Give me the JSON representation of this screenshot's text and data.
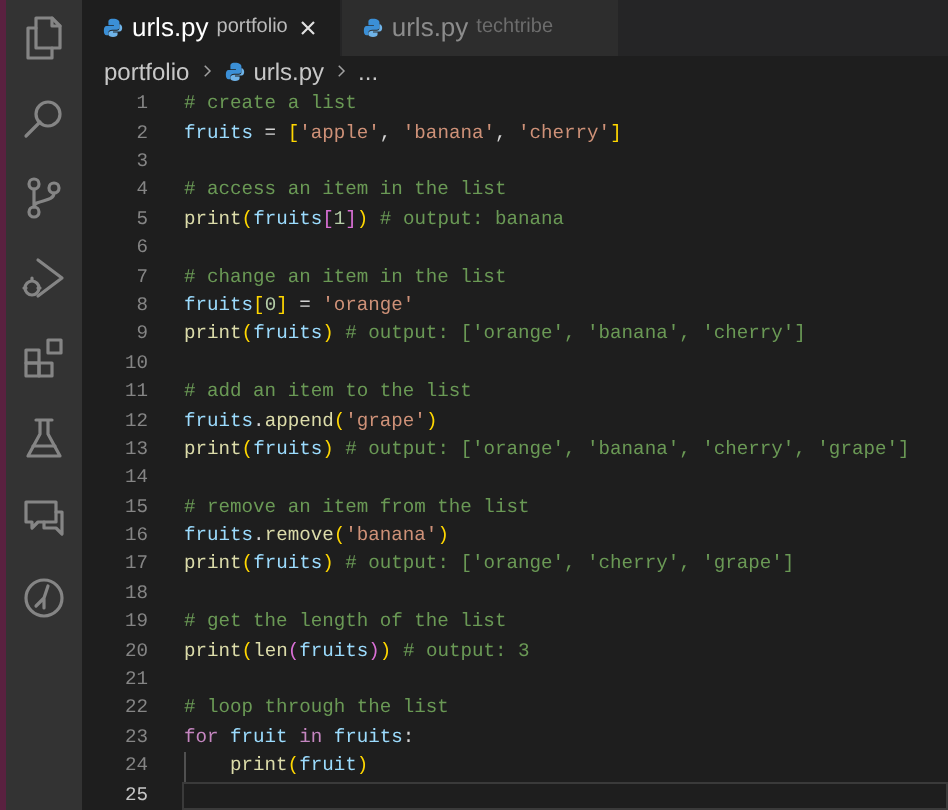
{
  "tabs": [
    {
      "label": "urls.py",
      "description": "portfolio",
      "selected": true
    },
    {
      "label": "urls.py",
      "description": "techtribe",
      "selected": false
    }
  ],
  "breadcrumbs": [
    "portfolio",
    "urls.py",
    "..."
  ],
  "activity_bar": [
    {
      "kind": "files"
    },
    {
      "kind": "search"
    },
    {
      "kind": "source-control"
    },
    {
      "kind": "run"
    },
    {
      "kind": "extensions"
    },
    {
      "kind": "testing"
    },
    {
      "kind": "remote"
    },
    {
      "kind": "timeline"
    }
  ],
  "lines": [
    {
      "number": "1",
      "current": false,
      "tokens": [
        {
          "kind": "comment",
          "text": "# create a list"
        }
      ]
    },
    {
      "number": "2",
      "current": false,
      "tokens": [
        {
          "kind": "variable",
          "text": "fruits"
        },
        {
          "kind": "plain",
          "text": " = "
        },
        {
          "kind": "bracket1",
          "text": "["
        },
        {
          "kind": "string",
          "text": "'apple'"
        },
        {
          "kind": "plain",
          "text": ", "
        },
        {
          "kind": "string",
          "text": "'banana'"
        },
        {
          "kind": "plain",
          "text": ", "
        },
        {
          "kind": "string",
          "text": "'cherry'"
        },
        {
          "kind": "bracket1",
          "text": "]"
        }
      ]
    },
    {
      "number": "3",
      "current": false
    },
    {
      "number": "4",
      "current": false,
      "tokens": [
        {
          "kind": "comment",
          "text": "# access an item in the list"
        }
      ]
    },
    {
      "number": "5",
      "current": false,
      "tokens": [
        {
          "kind": "function",
          "text": "print"
        },
        {
          "kind": "bracket1",
          "text": "("
        },
        {
          "kind": "variable",
          "text": "fruits"
        },
        {
          "kind": "bracket2",
          "text": "["
        },
        {
          "kind": "number",
          "text": "1"
        },
        {
          "kind": "bracket2",
          "text": "]"
        },
        {
          "kind": "bracket1",
          "text": ")"
        },
        {
          "kind": "comment",
          "text": " # output: banana"
        }
      ]
    },
    {
      "number": "6",
      "current": false
    },
    {
      "number": "7",
      "current": false,
      "tokens": [
        {
          "kind": "comment",
          "text": "# change an item in the list"
        }
      ]
    },
    {
      "number": "8",
      "current": false,
      "tokens": [
        {
          "kind": "variable",
          "text": "fruits"
        },
        {
          "kind": "bracket1",
          "text": "["
        },
        {
          "kind": "number",
          "text": "0"
        },
        {
          "kind": "bracket1",
          "text": "]"
        },
        {
          "kind": "plain",
          "text": " = "
        },
        {
          "kind": "string",
          "text": "'orange'"
        }
      ]
    },
    {
      "number": "9",
      "current": false,
      "tokens": [
        {
          "kind": "function",
          "text": "print"
        },
        {
          "kind": "bracket1",
          "text": "("
        },
        {
          "kind": "variable",
          "text": "fruits"
        },
        {
          "kind": "bracket1",
          "text": ")"
        },
        {
          "kind": "comment",
          "text": " # output: ['orange', 'banana', 'cherry']"
        }
      ]
    },
    {
      "number": "10",
      "current": false
    },
    {
      "number": "11",
      "current": false,
      "tokens": [
        {
          "kind": "comment",
          "text": "# add an item to the list"
        }
      ]
    },
    {
      "number": "12",
      "current": false,
      "tokens": [
        {
          "kind": "variable",
          "text": "fruits"
        },
        {
          "kind": "plain",
          "text": "."
        },
        {
          "kind": "function",
          "text": "append"
        },
        {
          "kind": "bracket1",
          "text": "("
        },
        {
          "kind": "string",
          "text": "'grape'"
        },
        {
          "kind": "bracket1",
          "text": ")"
        }
      ]
    },
    {
      "number": "13",
      "current": false,
      "tokens": [
        {
          "kind": "function",
          "text": "print"
        },
        {
          "kind": "bracket1",
          "text": "("
        },
        {
          "kind": "variable",
          "text": "fruits"
        },
        {
          "kind": "bracket1",
          "text": ")"
        },
        {
          "kind": "comment",
          "text": " # output: ['orange', 'banana', 'cherry', 'grape']"
        }
      ]
    },
    {
      "number": "14",
      "current": false
    },
    {
      "number": "15",
      "current": false,
      "tokens": [
        {
          "kind": "comment",
          "text": "# remove an item from the list"
        }
      ]
    },
    {
      "number": "16",
      "current": false,
      "tokens": [
        {
          "kind": "variable",
          "text": "fruits"
        },
        {
          "kind": "plain",
          "text": "."
        },
        {
          "kind": "function",
          "text": "remove"
        },
        {
          "kind": "bracket1",
          "text": "("
        },
        {
          "kind": "string",
          "text": "'banana'"
        },
        {
          "kind": "bracket1",
          "text": ")"
        }
      ]
    },
    {
      "number": "17",
      "current": false,
      "tokens": [
        {
          "kind": "function",
          "text": "print"
        },
        {
          "kind": "bracket1",
          "text": "("
        },
        {
          "kind": "variable",
          "text": "fruits"
        },
        {
          "kind": "bracket1",
          "text": ")"
        },
        {
          "kind": "comment",
          "text": " # output: ['orange', 'cherry', 'grape']"
        }
      ]
    },
    {
      "number": "18",
      "current": false
    },
    {
      "number": "19",
      "current": false,
      "tokens": [
        {
          "kind": "comment",
          "text": "# get the length of the list"
        }
      ]
    },
    {
      "number": "20",
      "current": false,
      "tokens": [
        {
          "kind": "function",
          "text": "print"
        },
        {
          "kind": "bracket1",
          "text": "("
        },
        {
          "kind": "function",
          "text": "len"
        },
        {
          "kind": "bracket2",
          "text": "("
        },
        {
          "kind": "variable",
          "text": "fruits"
        },
        {
          "kind": "bracket2",
          "text": ")"
        },
        {
          "kind": "bracket1",
          "text": ")"
        },
        {
          "kind": "comment",
          "text": " # output: 3"
        }
      ]
    },
    {
      "number": "21",
      "current": false
    },
    {
      "number": "22",
      "current": false,
      "tokens": [
        {
          "kind": "comment",
          "text": "# loop through the list"
        }
      ]
    },
    {
      "number": "23",
      "current": false,
      "tokens": [
        {
          "kind": "keyword",
          "text": "for "
        },
        {
          "kind": "variable",
          "text": "fruit "
        },
        {
          "kind": "keyword",
          "text": "in "
        },
        {
          "kind": "variable",
          "text": "fruits"
        },
        {
          "kind": "plain",
          "text": ":"
        }
      ]
    },
    {
      "number": "24",
      "current": false,
      "indent": true,
      "tokens": [
        {
          "kind": "function",
          "text": "print"
        },
        {
          "kind": "bracket1",
          "text": "("
        },
        {
          "kind": "variable",
          "text": "fruit"
        },
        {
          "kind": "bracket1",
          "text": ")"
        }
      ]
    },
    {
      "number": "25",
      "current": true
    }
  ]
}
